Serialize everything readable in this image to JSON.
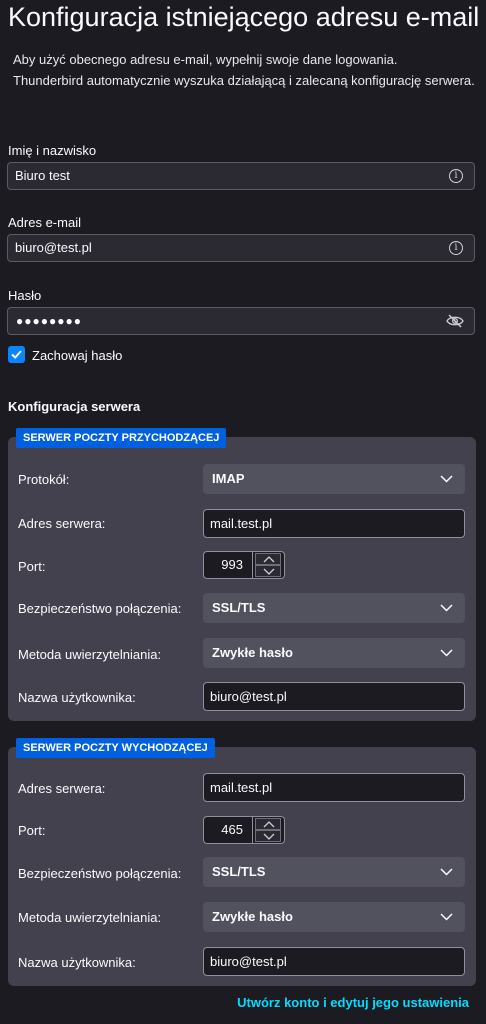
{
  "header": {
    "title": "Konfiguracja istniejącego adresu e-mail",
    "desc_line1": "Aby użyć obecnego adresu e-mail, wypełnij swoje dane logowania.",
    "desc_line2": "Thunderbird automatycznie wyszuka działającą i zalecaną konfigurację serwera."
  },
  "account": {
    "name_label": "Imię i nazwisko",
    "name_value": "Biuro test",
    "email_label": "Adres e-mail",
    "email_value": "biuro@test.pl",
    "password_label": "Hasło",
    "password_value": "●●●●●●●●",
    "remember_label": "Zachowaj hasło",
    "remember_checked": true
  },
  "server_config": {
    "title": "Konfiguracja serwera",
    "incoming": {
      "badge": "SERWER POCZTY PRZYCHODZĄCEJ",
      "protocol_label": "Protokół:",
      "protocol_value": "IMAP",
      "server_label": "Adres serwera:",
      "server_value": "mail.test.pl",
      "port_label": "Port:",
      "port_value": "993",
      "security_label": "Bezpieczeństwo połączenia:",
      "security_value": "SSL/TLS",
      "auth_label": "Metoda uwierzytelniania:",
      "auth_value": "Zwykłe hasło",
      "username_label": "Nazwa użytkownika:",
      "username_value": "biuro@test.pl"
    },
    "outgoing": {
      "badge": "SERWER POCZTY WYCHODZĄCEJ",
      "server_label": "Adres serwera:",
      "server_value": "mail.test.pl",
      "port_label": "Port:",
      "port_value": "465",
      "security_label": "Bezpieczeństwo połączenia:",
      "security_value": "SSL/TLS",
      "auth_label": "Metoda uwierzytelniania:",
      "auth_value": "Zwykłe hasło",
      "username_label": "Nazwa użytkownika:",
      "username_value": "biuro@test.pl"
    }
  },
  "footer": {
    "link": "Utwórz konto i edytuj jego ustawienia"
  },
  "colors": {
    "background": "#1c1b22",
    "panel": "#42414d",
    "accent": "#0060df",
    "link": "#00ddff"
  }
}
